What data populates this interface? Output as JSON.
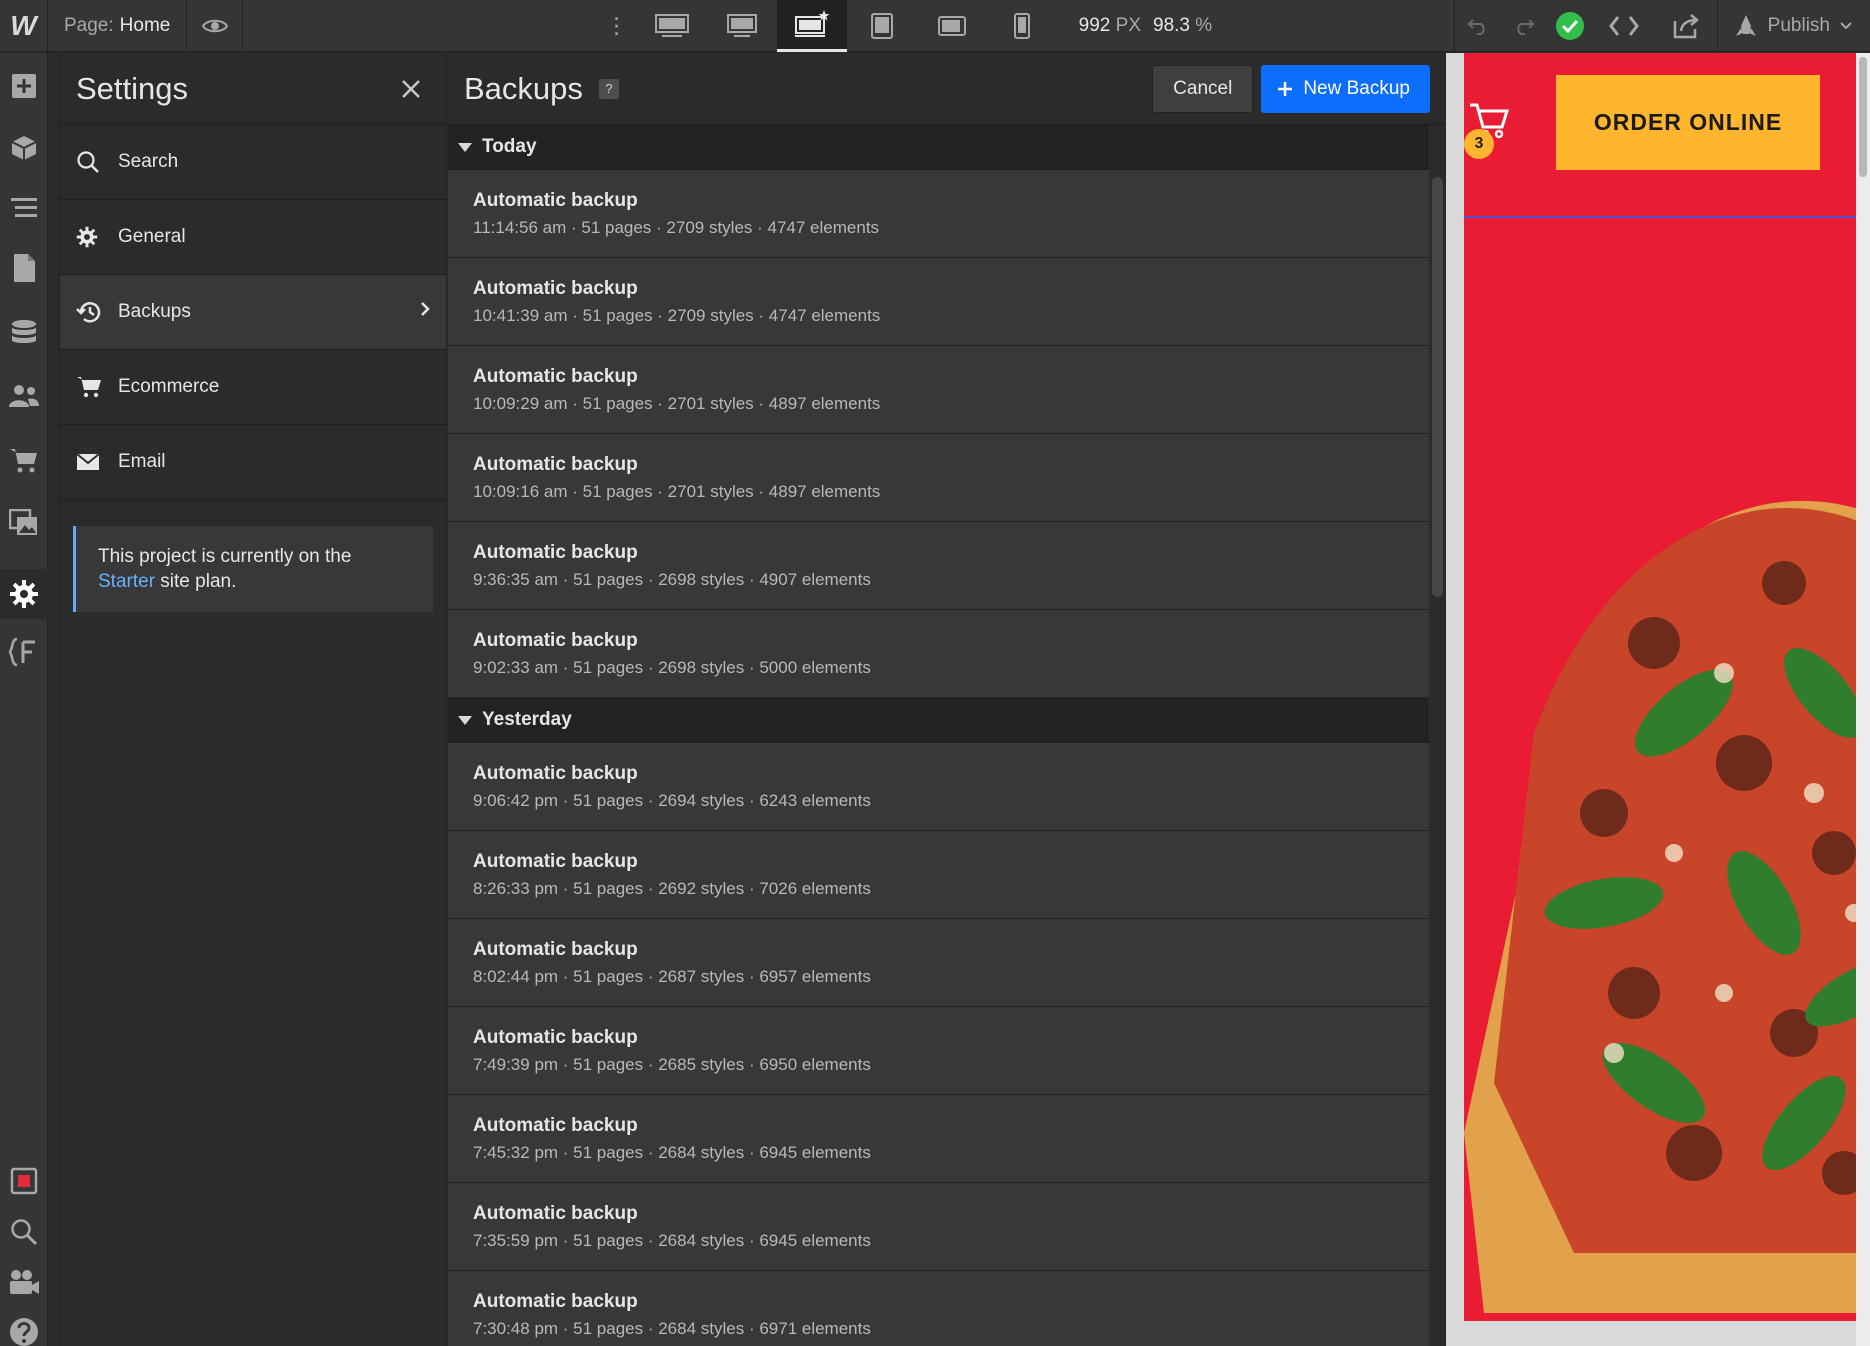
{
  "app": {
    "logo": "W"
  },
  "topbar": {
    "page_label": "Page:",
    "page_value": "Home",
    "width_value": "992",
    "width_unit": "PX",
    "zoom_value": "98.3",
    "zoom_unit": "%",
    "publish_label": "Publish"
  },
  "settings": {
    "title": "Settings",
    "nav": [
      {
        "label": "Search",
        "icon": "search-icon"
      },
      {
        "label": "General",
        "icon": "gear-icon"
      },
      {
        "label": "Backups",
        "icon": "history-icon"
      },
      {
        "label": "Ecommerce",
        "icon": "cart-icon"
      },
      {
        "label": "Email",
        "icon": "envelope-icon"
      }
    ],
    "plan_note": {
      "prefix": "This project is currently on the",
      "link": "Starter",
      "suffix": " site plan."
    }
  },
  "backups": {
    "title": "Backups",
    "help": "?",
    "cancel_label": "Cancel",
    "new_label": "New Backup",
    "groups": [
      {
        "label": "Today",
        "items": [
          {
            "title": "Automatic backup",
            "meta": "11:14:56 am · 51 pages · 2709 styles · 4747 elements"
          },
          {
            "title": "Automatic backup",
            "meta": "10:41:39 am · 51 pages · 2709 styles · 4747 elements"
          },
          {
            "title": "Automatic backup",
            "meta": "10:09:29 am · 51 pages · 2701 styles · 4897 elements"
          },
          {
            "title": "Automatic backup",
            "meta": "10:09:16 am · 51 pages · 2701 styles · 4897 elements"
          },
          {
            "title": "Automatic backup",
            "meta": "9:36:35 am · 51 pages · 2698 styles · 4907 elements"
          },
          {
            "title": "Automatic backup",
            "meta": "9:02:33 am · 51 pages · 2698 styles · 5000 elements"
          }
        ]
      },
      {
        "label": "Yesterday",
        "items": [
          {
            "title": "Automatic backup",
            "meta": "9:06:42 pm · 51 pages · 2694 styles · 6243 elements"
          },
          {
            "title": "Automatic backup",
            "meta": "8:26:33 pm · 51 pages · 2692 styles · 7026 elements"
          },
          {
            "title": "Automatic backup",
            "meta": "8:02:44 pm · 51 pages · 2687 styles · 6957 elements"
          },
          {
            "title": "Automatic backup",
            "meta": "7:49:39 pm · 51 pages · 2685 styles · 6950 elements"
          },
          {
            "title": "Automatic backup",
            "meta": "7:45:32 pm · 51 pages · 2684 styles · 6945 elements"
          },
          {
            "title": "Automatic backup",
            "meta": "7:35:59 pm · 51 pages · 2684 styles · 6945 elements"
          },
          {
            "title": "Automatic backup",
            "meta": "7:30:48 pm · 51 pages · 2684 styles · 6971 elements"
          }
        ]
      }
    ]
  },
  "preview": {
    "cart_count": "3",
    "order_button": "ORDER ONLINE"
  },
  "colors": {
    "accent_blue": "#0d6dfd",
    "status_green": "#2fbf4a",
    "brand_red": "#e91c34",
    "brand_yellow": "#ffb52e",
    "link_blue": "#6aaeff"
  }
}
